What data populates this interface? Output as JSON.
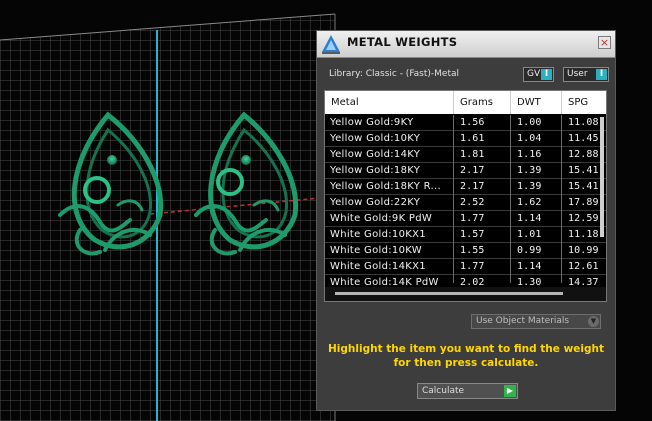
{
  "panel": {
    "title": "METAL WEIGHTS",
    "close_glyph": "×",
    "library_label": "Library: Classic - (Fast)-Metal",
    "toggles": [
      {
        "label": "GV",
        "knob": "I"
      },
      {
        "label": "User",
        "knob": "I"
      }
    ],
    "table": {
      "headers": {
        "metal": "Metal",
        "grams": "Grams",
        "dwt": "DWT",
        "spg": "SPG"
      },
      "rows": [
        {
          "metal": "Yellow Gold:9KY",
          "grams": "1.56",
          "dwt": "1.00",
          "spg": "11.08"
        },
        {
          "metal": "Yellow Gold:10KY",
          "grams": "1.61",
          "dwt": "1.04",
          "spg": "11.45"
        },
        {
          "metal": "Yellow Gold:14KY",
          "grams": "1.81",
          "dwt": "1.16",
          "spg": "12.88"
        },
        {
          "metal": "Yellow Gold:18KY",
          "grams": "2.17",
          "dwt": "1.39",
          "spg": "15.41"
        },
        {
          "metal": "Yellow Gold:18KY R...",
          "grams": "2.17",
          "dwt": "1.39",
          "spg": "15.41"
        },
        {
          "metal": "Yellow Gold:22KY",
          "grams": "2.52",
          "dwt": "1.62",
          "spg": "17.89"
        },
        {
          "metal": "White Gold:9K PdW",
          "grams": "1.77",
          "dwt": "1.14",
          "spg": "12.59"
        },
        {
          "metal": "White Gold:10KX1",
          "grams": "1.57",
          "dwt": "1.01",
          "spg": "11.18"
        },
        {
          "metal": "White Gold:10KW",
          "grams": "1.55",
          "dwt": "0.99",
          "spg": "10.99"
        },
        {
          "metal": "White Gold:14KX1",
          "grams": "1.77",
          "dwt": "1.14",
          "spg": "12.61"
        },
        {
          "metal": "White Gold:14K PdW",
          "grams": "2.02",
          "dwt": "1.30",
          "spg": "14.37"
        }
      ]
    },
    "material_dropdown": "Use Object Materials",
    "instruction_line1": "Highlight the item you want to find the weight",
    "instruction_line2": "for then press calculate.",
    "calculate_label": "Calculate",
    "calculate_icon": "▶"
  },
  "viewport": {
    "grid_color": "#5a5a5a",
    "axis_color": "#1fb8c8",
    "model_color": "#1e8f63",
    "icons": [
      "logo-icon",
      "close-icon",
      "play-icon",
      "chevron-down-icon"
    ]
  }
}
